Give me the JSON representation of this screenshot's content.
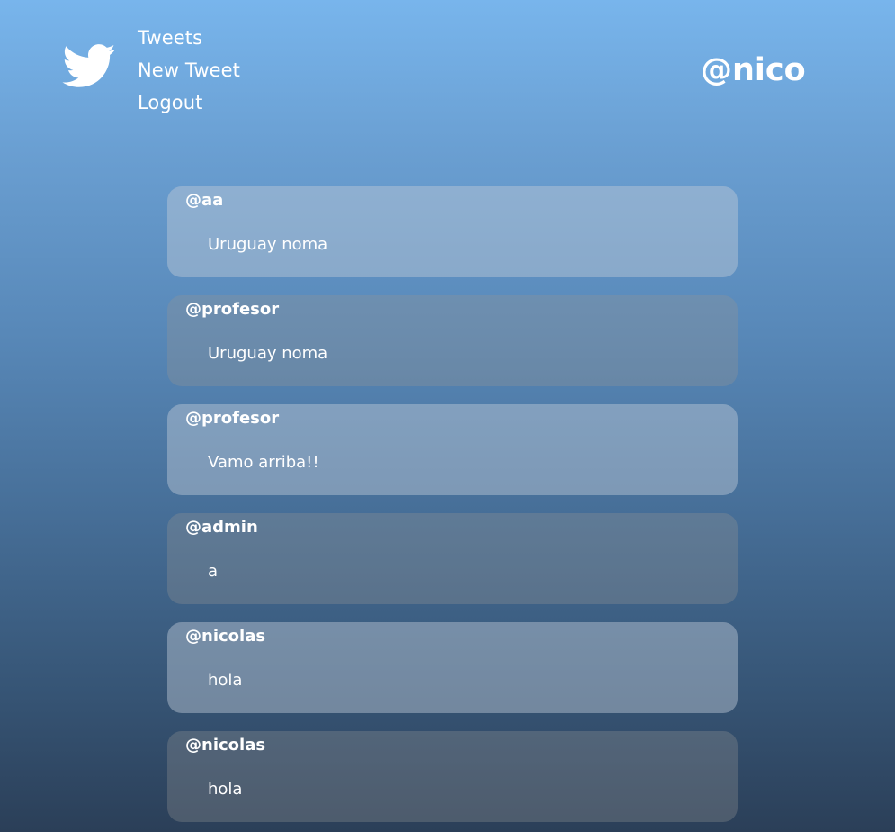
{
  "header": {
    "logo_icon": "twitter-bird-icon",
    "nav": [
      {
        "label": "Tweets"
      },
      {
        "label": "New Tweet"
      },
      {
        "label": "Logout"
      }
    ],
    "username": "@nico"
  },
  "tweets": [
    {
      "author": "@aa",
      "text": "Uruguay noma"
    },
    {
      "author": "@profesor",
      "text": "Uruguay noma"
    },
    {
      "author": "@profesor",
      "text": "Vamo arriba!!"
    },
    {
      "author": "@admin",
      "text": "a"
    },
    {
      "author": "@nicolas",
      "text": "hola"
    },
    {
      "author": "@nicolas",
      "text": "hola"
    }
  ]
}
